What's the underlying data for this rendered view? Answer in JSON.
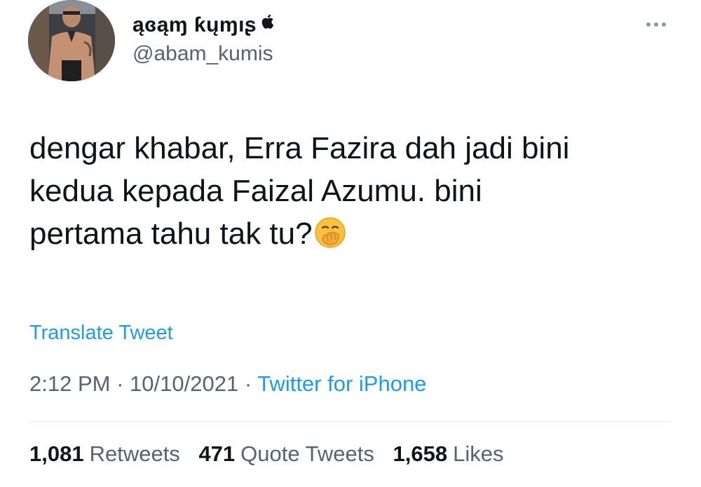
{
  "user": {
    "display_name": "ąɞąɱ ƙųɱıʂ",
    "handle": "@abam_kumis",
    "badge_icon": "apple-icon",
    "avatar_icon": "profile-photo"
  },
  "tweet": {
    "lines": [
      "dengar khabar, Erra Fazira dah jadi bini",
      "kedua kepada Faizal Azumu. bini",
      "pertama tahu tak tu?"
    ],
    "emoji": "face-with-hand-over-mouth-emoji"
  },
  "translate_label": "Translate Tweet",
  "meta": {
    "time": "2:12 PM",
    "date": "10/10/2021",
    "separator": "·",
    "source": "Twitter for iPhone"
  },
  "stats": {
    "retweets": {
      "count": "1,081",
      "label": "Retweets"
    },
    "quotes": {
      "count": "471",
      "label": "Quote Tweets"
    },
    "likes": {
      "count": "1,658",
      "label": "Likes"
    }
  },
  "colors": {
    "text": "#0f1419",
    "secondary": "#536471",
    "link": "#1d9bf0",
    "divider": "#e6ecf0"
  }
}
